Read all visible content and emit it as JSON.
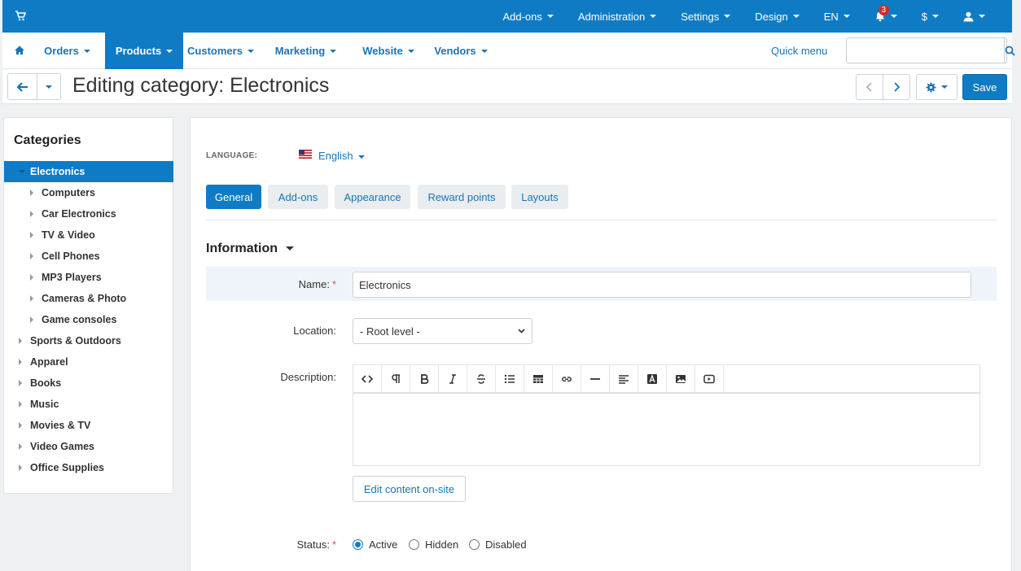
{
  "topbar": {
    "items": [
      {
        "label": "Add-ons",
        "caret": true
      },
      {
        "label": "Administration",
        "caret": true
      },
      {
        "label": "Settings",
        "caret": true
      },
      {
        "label": "Design",
        "caret": true
      },
      {
        "label": "EN",
        "caret": true
      },
      {
        "label": "",
        "icon": "bell-icon",
        "badge": "3",
        "caret": true
      },
      {
        "label": "$",
        "caret": true
      },
      {
        "label": "",
        "icon": "user-icon",
        "caret": true
      }
    ],
    "color": "#0f7bc4"
  },
  "mainnav": {
    "items": [
      {
        "label": "Orders"
      },
      {
        "label": "Products"
      },
      {
        "label": "Customers"
      },
      {
        "label": "Marketing"
      },
      {
        "label": "Website"
      },
      {
        "label": "Vendors"
      }
    ],
    "active": "Products",
    "quick_menu": "Quick menu",
    "search_placeholder": ""
  },
  "page": {
    "title": "Editing category: Electronics",
    "save": "Save"
  },
  "sidebar": {
    "title": "Categories",
    "items": [
      {
        "label": "Electronics",
        "selected": true,
        "level": 0
      },
      {
        "label": "Computers",
        "level": 1
      },
      {
        "label": "Car Electronics",
        "level": 1
      },
      {
        "label": "TV & Video",
        "level": 1
      },
      {
        "label": "Cell Phones",
        "level": 1
      },
      {
        "label": "MP3 Players",
        "level": 1
      },
      {
        "label": "Cameras & Photo",
        "level": 1
      },
      {
        "label": "Game consoles",
        "level": 1
      },
      {
        "label": "Sports & Outdoors",
        "level": 0
      },
      {
        "label": "Apparel",
        "level": 0
      },
      {
        "label": "Books",
        "level": 0
      },
      {
        "label": "Music",
        "level": 0
      },
      {
        "label": "Movies & TV",
        "level": 0
      },
      {
        "label": "Video Games",
        "level": 0
      },
      {
        "label": "Office Supplies",
        "level": 0
      }
    ]
  },
  "content": {
    "language_label": "LANGUAGE:",
    "language_value": "English",
    "tabs": [
      "General",
      "Add-ons",
      "Appearance",
      "Reward points",
      "Layouts"
    ],
    "active_tab": "General",
    "section_title": "Information",
    "name_label": "Name:",
    "name_value": "Electronics",
    "location_label": "Location:",
    "location_value": "- Root level -",
    "description_label": "Description:",
    "editor_tools": [
      "code-icon",
      "paragraph-icon",
      "bold-icon",
      "italic-icon",
      "strikethrough-icon",
      "list-icon",
      "table-icon",
      "link-icon",
      "hr-icon",
      "align-icon",
      "font-color-icon",
      "image-icon",
      "video-icon"
    ],
    "edit_onsite": "Edit content on-site",
    "status_label": "Status:",
    "status_options": [
      "Active",
      "Hidden",
      "Disabled"
    ],
    "status_selected": "Active"
  }
}
